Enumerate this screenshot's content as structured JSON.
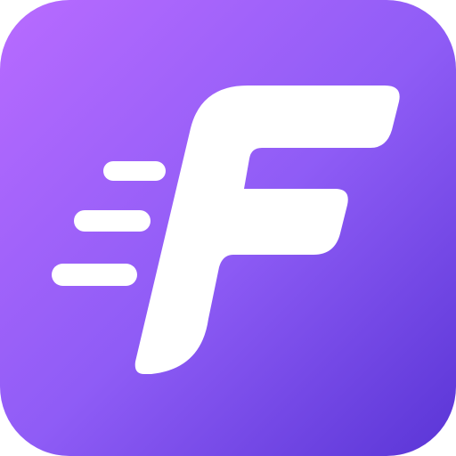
{
  "icon": {
    "logo_letter": "F",
    "logo_description": "fast-f-logo-icon",
    "colors": {
      "gradient_start": "#B86BFF",
      "gradient_mid": "#8F5CF6",
      "gradient_end": "#5A35D6",
      "glyph": "#FFFFFF",
      "background": "#FFFFFF"
    }
  }
}
